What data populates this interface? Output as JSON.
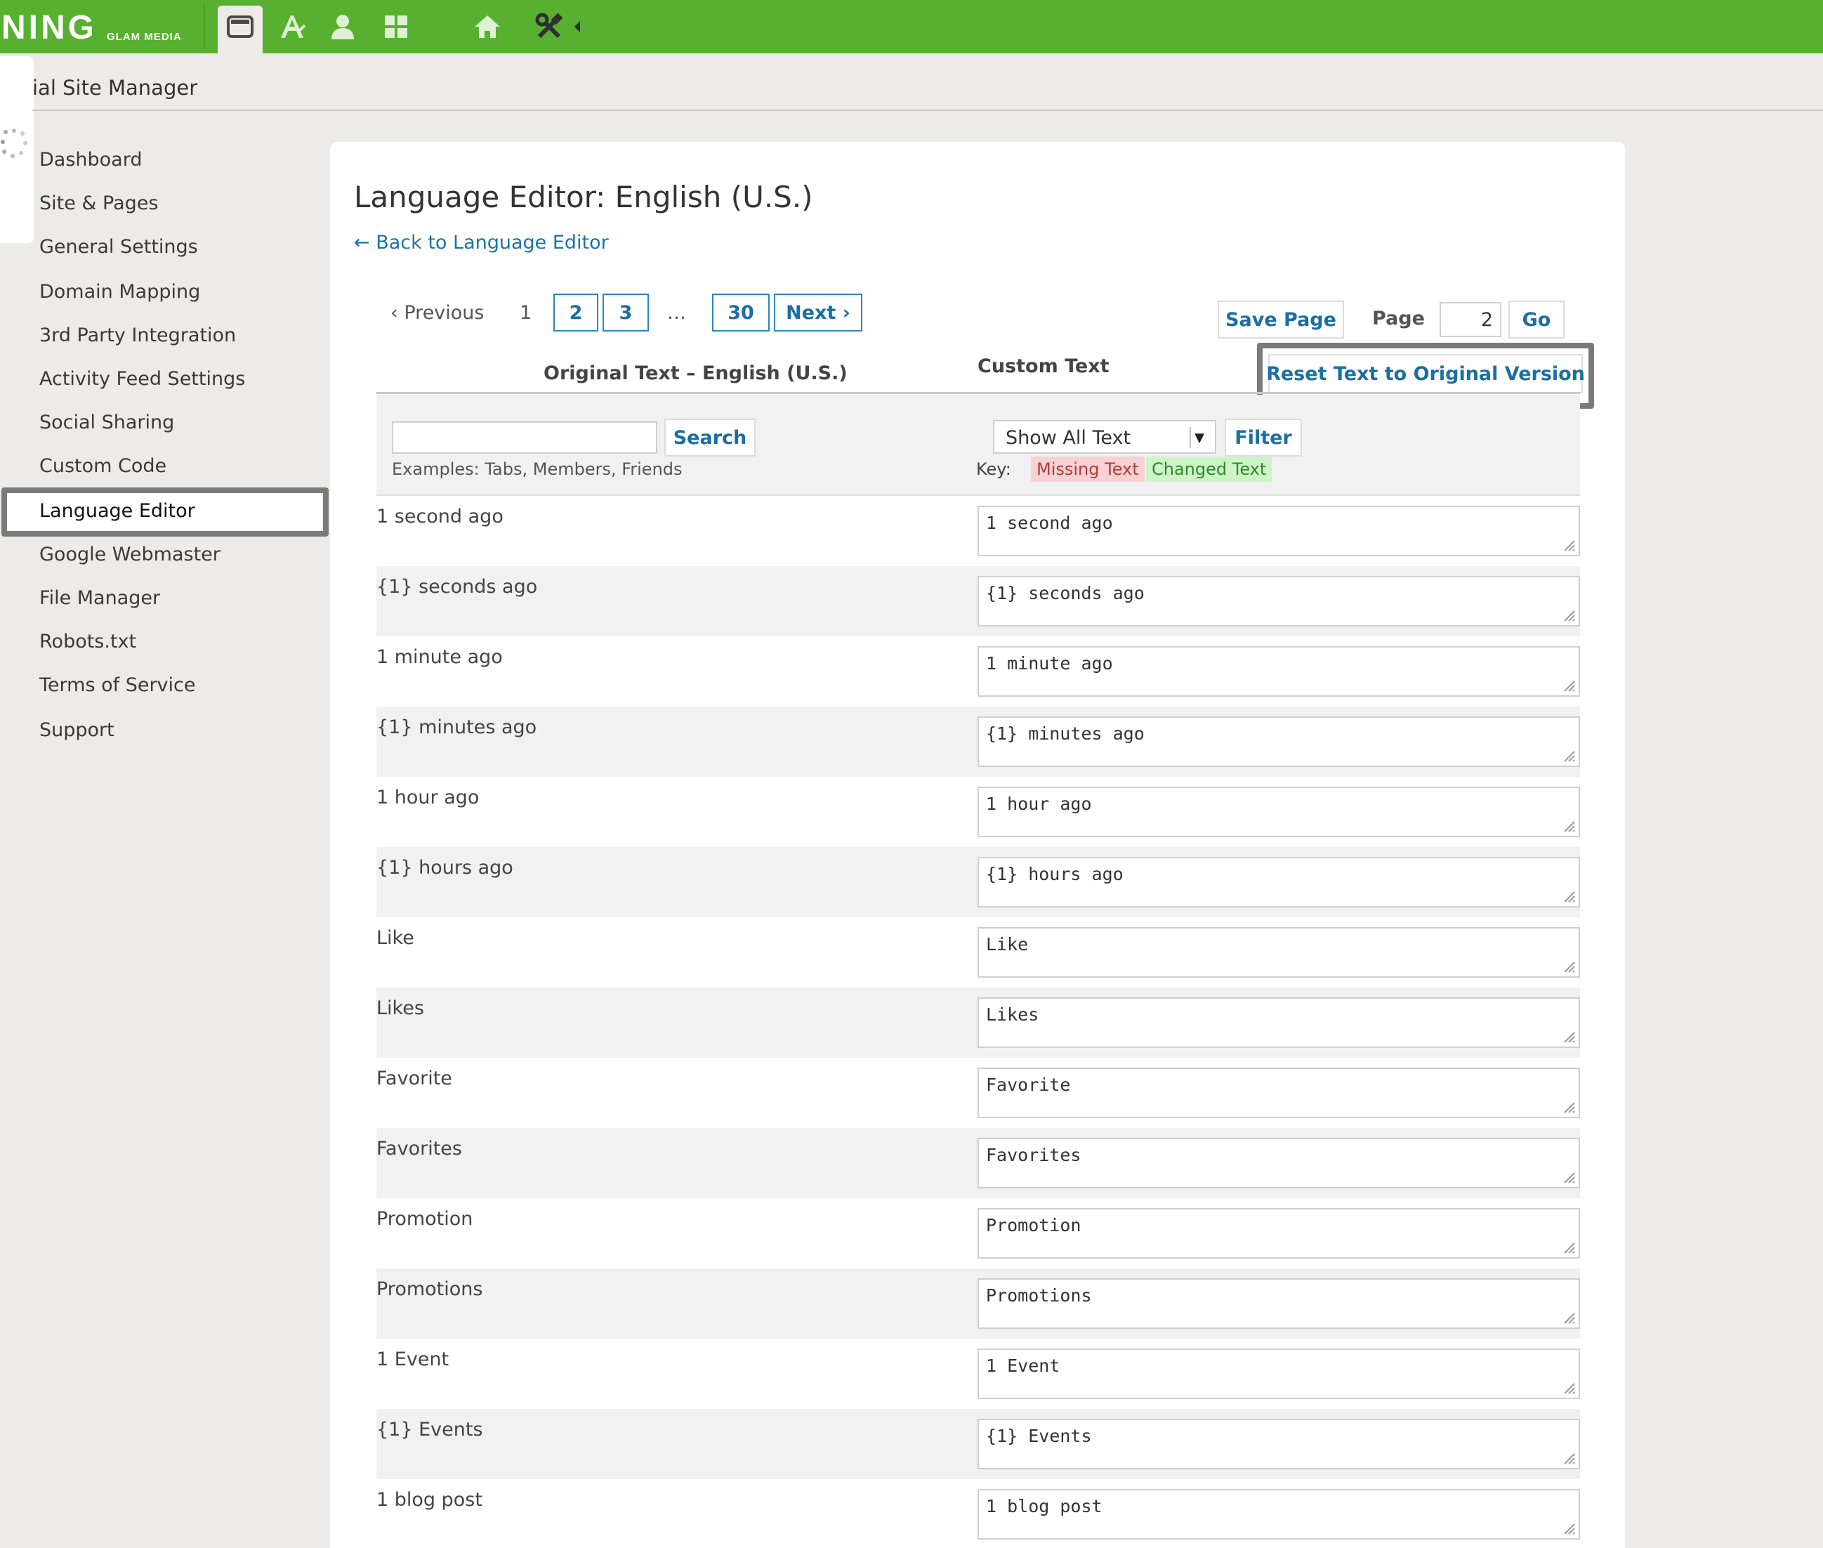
{
  "app": {
    "brand": "NING",
    "brand_sub": "GLAM MEDIA",
    "site_title": "ial Site Manager"
  },
  "toolbar": {
    "icons": [
      "browser-window-icon",
      "appearance-icon",
      "user-icon",
      "grid-icon",
      "home-icon",
      "tools-icon",
      "collapse-arrow-icon"
    ]
  },
  "sidebar": {
    "active_index": 8,
    "items": [
      {
        "label": "Dashboard"
      },
      {
        "label": "Site & Pages"
      },
      {
        "label": "General Settings"
      },
      {
        "label": "Domain Mapping"
      },
      {
        "label": "3rd Party Integration"
      },
      {
        "label": "Activity Feed Settings"
      },
      {
        "label": "Social Sharing"
      },
      {
        "label": "Custom Code"
      },
      {
        "label": "Language Editor"
      },
      {
        "label": "Google Webmaster"
      },
      {
        "label": "File Manager"
      },
      {
        "label": "Robots.txt"
      },
      {
        "label": "Terms of Service"
      },
      {
        "label": "Support"
      }
    ]
  },
  "main": {
    "title": "Language Editor: English (U.S.)",
    "back_link": "← Back to Language Editor",
    "pagination": {
      "previous": "‹ Previous",
      "current": "1",
      "page2": "2",
      "page3": "3",
      "ellipsis": "…",
      "last": "30",
      "next": "Next ›"
    },
    "save_page": "Save Page",
    "page_label": "Page",
    "page_value": "2",
    "go": "Go",
    "reset": "Reset Text to Original Version",
    "col_original": "Original Text – English (U.S.)",
    "col_custom": "Custom Text",
    "search_button": "Search",
    "search_value": "",
    "examples": "Examples: Tabs, Members, Friends",
    "filter_select": "Show All Text",
    "filter_button": "Filter",
    "key_label": "Key:",
    "key_missing": "Missing Text",
    "key_changed": "Changed Text",
    "colors": {
      "accent": "#58b031",
      "link": "#1a6fa3",
      "missing_bg": "#f8d2d2",
      "changed_bg": "#cdf3c8"
    }
  },
  "rows": [
    {
      "original": "1 second ago",
      "custom": "1 second ago"
    },
    {
      "original": "{1} seconds ago",
      "custom": "{1} seconds ago"
    },
    {
      "original": "1 minute ago",
      "custom": "1 minute ago"
    },
    {
      "original": "{1} minutes ago",
      "custom": "{1} minutes ago"
    },
    {
      "original": "1 hour ago",
      "custom": "1 hour ago"
    },
    {
      "original": "{1} hours ago",
      "custom": "{1} hours ago"
    },
    {
      "original": "Like",
      "custom": "Like"
    },
    {
      "original": "Likes",
      "custom": "Likes"
    },
    {
      "original": "Favorite",
      "custom": "Favorite"
    },
    {
      "original": "Favorites",
      "custom": "Favorites"
    },
    {
      "original": "Promotion",
      "custom": "Promotion"
    },
    {
      "original": "Promotions",
      "custom": "Promotions"
    },
    {
      "original": "1 Event",
      "custom": "1 Event"
    },
    {
      "original": "{1} Events",
      "custom": "{1} Events"
    },
    {
      "original": "1 blog post",
      "custom": "1 blog post"
    }
  ]
}
